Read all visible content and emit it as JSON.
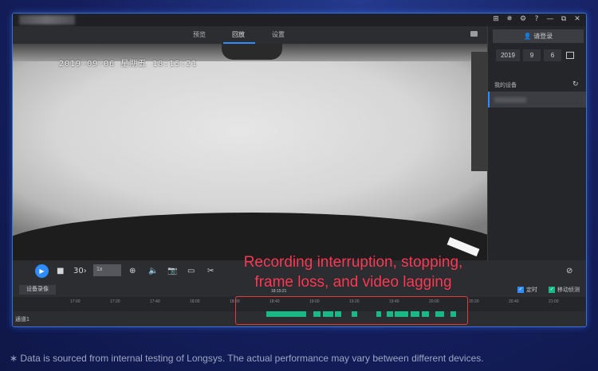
{
  "window": {
    "controls": [
      "⊞",
      "✵",
      "⚙",
      "?",
      "—",
      "⧉",
      "✕"
    ]
  },
  "nav": {
    "tabs": [
      {
        "label": "预览",
        "active": false
      },
      {
        "label": "回放",
        "active": true
      },
      {
        "label": "设置",
        "active": false
      }
    ]
  },
  "video": {
    "timestamp": "2019-09-06 星期五 18:15:21"
  },
  "sidebar": {
    "login_label": "请登录",
    "date": {
      "year": "2019",
      "month": "9",
      "day": "6"
    },
    "devices_label": "我的设备"
  },
  "controls": {
    "speed": "1x",
    "mode_label": "30"
  },
  "timeline": {
    "download_label": "设备录像",
    "checkbox_timed": "定时",
    "checkbox_motion": "移动侦测",
    "channel_label": "通道1",
    "playhead_time": "18:15:21",
    "ticks": [
      "17:00",
      "17:20",
      "17:40",
      "18:00",
      "18:20",
      "18:40",
      "19:00",
      "19:20",
      "19:40",
      "20:00",
      "20:20",
      "20:40",
      "21:00"
    ],
    "segments": [
      {
        "start": 0.441,
        "end": 0.51
      },
      {
        "start": 0.523,
        "end": 0.535
      },
      {
        "start": 0.54,
        "end": 0.558
      },
      {
        "start": 0.56,
        "end": 0.571
      },
      {
        "start": 0.59,
        "end": 0.599
      },
      {
        "start": 0.632,
        "end": 0.641
      },
      {
        "start": 0.65,
        "end": 0.661
      },
      {
        "start": 0.665,
        "end": 0.688
      },
      {
        "start": 0.692,
        "end": 0.708
      },
      {
        "start": 0.712,
        "end": 0.724
      },
      {
        "start": 0.735,
        "end": 0.751
      },
      {
        "start": 0.762,
        "end": 0.771
      }
    ]
  },
  "annotation": {
    "line1": "Recording interruption, stopping,",
    "line2": "frame loss, and video lagging"
  },
  "footnote": "∗ Data is sourced from internal testing of Longsys. The actual performance may vary between different devices.",
  "colors": {
    "accent": "#2f8cff",
    "segment": "#19b986",
    "annotation": "#ff3a55"
  }
}
